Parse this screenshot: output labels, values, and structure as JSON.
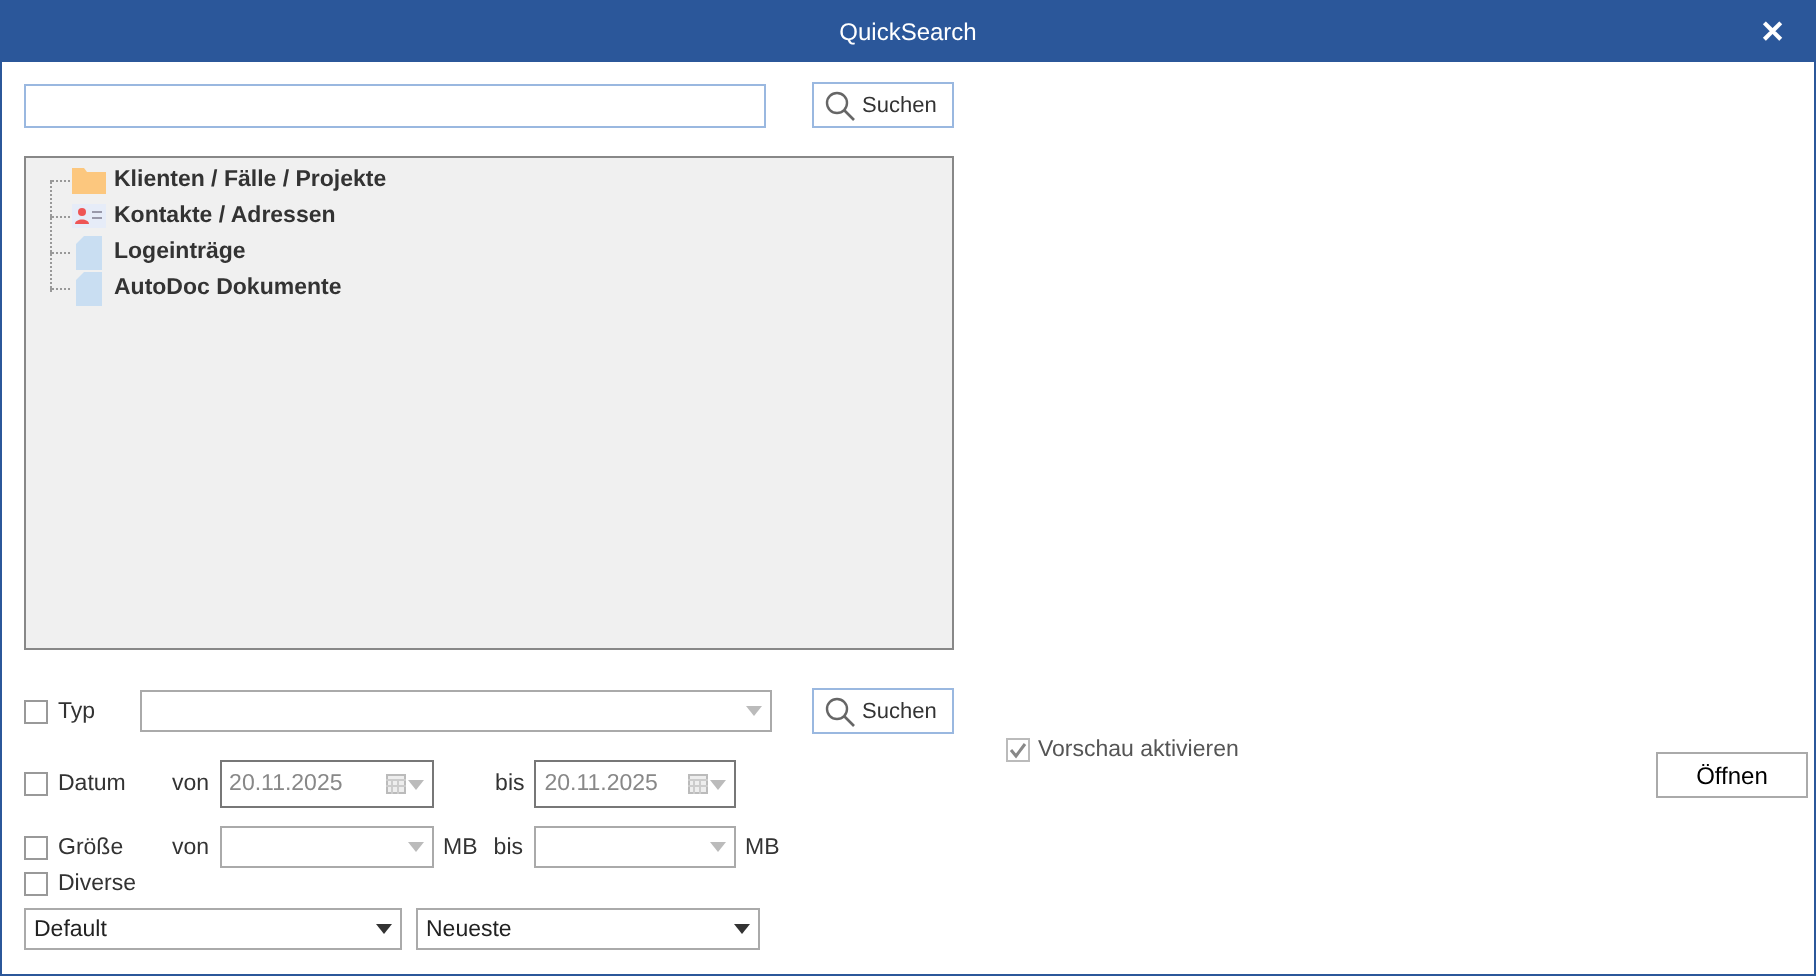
{
  "window": {
    "title": "QuickSearch",
    "close": "✕"
  },
  "search": {
    "button": "Suchen"
  },
  "tree": [
    {
      "label": "Klienten / Fälle / Projekte",
      "kind": "folder"
    },
    {
      "label": "Kontakte / Adressen",
      "kind": "contact"
    },
    {
      "label": "Logeinträge",
      "kind": "document"
    },
    {
      "label": "AutoDoc Dokumente",
      "kind": "document"
    }
  ],
  "filters": {
    "typ": {
      "label": "Typ",
      "checked": false,
      "button": "Suchen"
    },
    "datum": {
      "label": "Datum",
      "checked": false,
      "from_label": "von",
      "from": "20.11.2025",
      "to_label": "bis",
      "to": "20.11.2025"
    },
    "groesse": {
      "label": "Größe",
      "checked": false,
      "from_label": "von",
      "from_unit": "MB",
      "to_label": "bis",
      "to_unit": "MB"
    },
    "diverse": {
      "label": "Diverse",
      "checked": false
    },
    "sort": "Default",
    "order": "Neueste"
  },
  "preview": {
    "label": "Vorschau aktivieren",
    "checked": true,
    "disabled": true
  },
  "open_button": "Öffnen"
}
